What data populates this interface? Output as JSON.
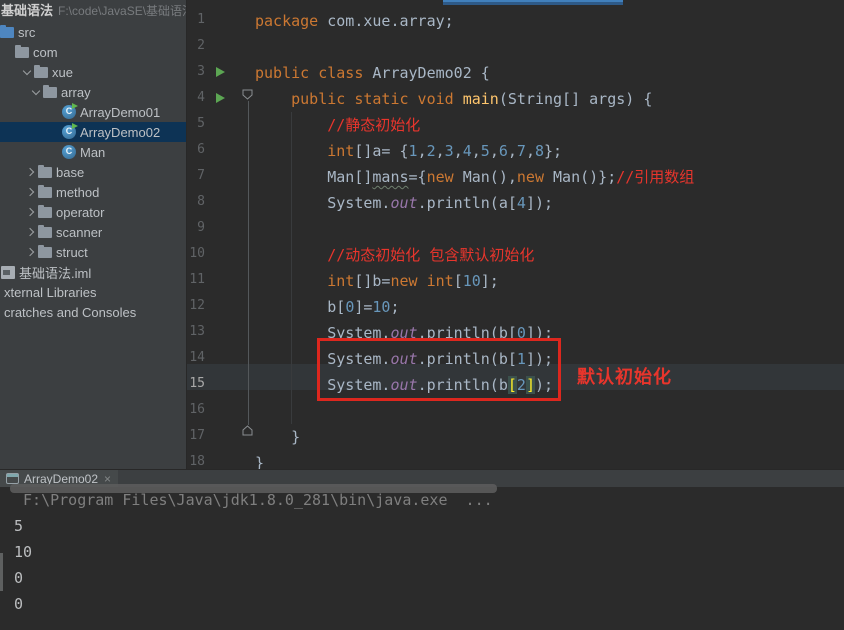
{
  "colors": {
    "annotation_red": "#E8352C",
    "tree_selection": "#0D3355",
    "keyword_orange": "#CC7832",
    "number_blue": "#6897BB",
    "run_green": "#5CA653",
    "tab_accent_blue": "#4180BC"
  },
  "project_panel": {
    "title": "基础语法",
    "path": "F:\\code\\JavaSE\\基础语法",
    "tree": [
      {
        "label": "src",
        "icon": "src-folder",
        "pad": 0
      },
      {
        "label": "com",
        "icon": "folder",
        "pad": 15
      },
      {
        "label": "xue",
        "icon": "folder",
        "chevron": "down",
        "pad": 22
      },
      {
        "label": "array",
        "icon": "folder",
        "chevron": "down",
        "pad": 31
      },
      {
        "label": "ArrayDemo01",
        "icon": "class-run",
        "pad": 62
      },
      {
        "label": "ArrayDemo02",
        "icon": "class-run",
        "pad": 62,
        "selected": true
      },
      {
        "label": "Man",
        "icon": "class",
        "pad": 62
      },
      {
        "label": "base",
        "icon": "folder",
        "chevron": "right",
        "pad": 26
      },
      {
        "label": "method",
        "icon": "folder",
        "chevron": "right",
        "pad": 26
      },
      {
        "label": "operator",
        "icon": "folder",
        "chevron": "right",
        "pad": 26
      },
      {
        "label": "scanner",
        "icon": "folder",
        "chevron": "right",
        "pad": 26
      },
      {
        "label": "struct",
        "icon": "folder",
        "chevron": "right",
        "pad": 26
      },
      {
        "label": "基础语法.iml",
        "icon": "module-file",
        "pad": 1
      },
      {
        "label": "xternal Libraries",
        "pad": 0
      },
      {
        "label": "cratches and Consoles",
        "pad": 0
      }
    ]
  },
  "editor": {
    "active_line": 15,
    "run_lines": [
      3,
      4
    ],
    "lines": [
      [
        {
          "t": "package",
          "c": "k"
        },
        {
          "t": " com.xue.array;",
          "c": "p"
        }
      ],
      [],
      [
        {
          "t": "public class",
          "c": "k"
        },
        {
          "t": " ArrayDemo02 {",
          "c": "p"
        }
      ],
      [
        {
          "t": "    ",
          "c": "p"
        },
        {
          "t": "public static void ",
          "c": "k"
        },
        {
          "t": "main",
          "c": "m"
        },
        {
          "t": "(String[] args) {",
          "c": "p"
        }
      ],
      [
        {
          "t": "        ",
          "c": "p"
        },
        {
          "t": "//静态初始化",
          "c": "c"
        }
      ],
      [
        {
          "t": "        ",
          "c": "p"
        },
        {
          "t": "int",
          "c": "k"
        },
        {
          "t": "[]a= {",
          "c": "p"
        },
        {
          "t": "1",
          "c": "n"
        },
        {
          "t": ",",
          "c": "p"
        },
        {
          "t": "2",
          "c": "n"
        },
        {
          "t": ",",
          "c": "p"
        },
        {
          "t": "3",
          "c": "n"
        },
        {
          "t": ",",
          "c": "p"
        },
        {
          "t": "4",
          "c": "n"
        },
        {
          "t": ",",
          "c": "p"
        },
        {
          "t": "5",
          "c": "n"
        },
        {
          "t": ",",
          "c": "p"
        },
        {
          "t": "6",
          "c": "n"
        },
        {
          "t": ",",
          "c": "p"
        },
        {
          "t": "7",
          "c": "n"
        },
        {
          "t": ",",
          "c": "p"
        },
        {
          "t": "8",
          "c": "n"
        },
        {
          "t": "};",
          "c": "p"
        }
      ],
      [
        {
          "t": "        ",
          "c": "p"
        },
        {
          "t": "Man[]",
          "c": "p"
        },
        {
          "t": "mans",
          "c": "u"
        },
        {
          "t": "={",
          "c": "p"
        },
        {
          "t": "new",
          "c": "k"
        },
        {
          "t": " Man()",
          "c": "p"
        },
        {
          "t": ",",
          "c": "p"
        },
        {
          "t": "new",
          "c": "k"
        },
        {
          "t": " Man()};",
          "c": "p"
        },
        {
          "t": "//引用数组",
          "c": "c"
        }
      ],
      [
        {
          "t": "        ",
          "c": "p"
        },
        {
          "t": "System.",
          "c": "p"
        },
        {
          "t": "out",
          "c": "f"
        },
        {
          "t": ".println(a[",
          "c": "p"
        },
        {
          "t": "4",
          "c": "n"
        },
        {
          "t": "]);",
          "c": "p"
        }
      ],
      [],
      [
        {
          "t": "        ",
          "c": "p"
        },
        {
          "t": "//动态初始化 包含默认初始化",
          "c": "c"
        }
      ],
      [
        {
          "t": "        ",
          "c": "p"
        },
        {
          "t": "int",
          "c": "k"
        },
        {
          "t": "[]b=",
          "c": "p"
        },
        {
          "t": "new ",
          "c": "k"
        },
        {
          "t": "int",
          "c": "k"
        },
        {
          "t": "[",
          "c": "p"
        },
        {
          "t": "10",
          "c": "n"
        },
        {
          "t": "];",
          "c": "p"
        }
      ],
      [
        {
          "t": "        ",
          "c": "p"
        },
        {
          "t": "b[",
          "c": "p"
        },
        {
          "t": "0",
          "c": "n"
        },
        {
          "t": "]=",
          "c": "p"
        },
        {
          "t": "10",
          "c": "n"
        },
        {
          "t": ";",
          "c": "p"
        }
      ],
      [
        {
          "t": "        ",
          "c": "p"
        },
        {
          "t": "System.",
          "c": "p"
        },
        {
          "t": "out",
          "c": "f"
        },
        {
          "t": ".println(b[",
          "c": "p"
        },
        {
          "t": "0",
          "c": "n"
        },
        {
          "t": "]);",
          "c": "p"
        }
      ],
      [
        {
          "t": "        ",
          "c": "p"
        },
        {
          "t": "System.",
          "c": "p"
        },
        {
          "t": "out",
          "c": "f"
        },
        {
          "t": ".println(b[",
          "c": "p"
        },
        {
          "t": "1",
          "c": "n"
        },
        {
          "t": "]);",
          "c": "p"
        }
      ],
      [
        {
          "t": "        ",
          "c": "p"
        },
        {
          "t": "System.",
          "c": "p"
        },
        {
          "t": "out",
          "c": "f"
        },
        {
          "t": ".println(b",
          "c": "p"
        },
        {
          "t": "[",
          "c": "bh"
        },
        {
          "t": "2",
          "c": "n"
        },
        {
          "t": "]",
          "c": "bh"
        },
        {
          "t": ");",
          "c": "p"
        }
      ],
      [],
      [
        {
          "t": "    }",
          "c": "p"
        }
      ],
      [
        {
          "t": "}",
          "c": "p"
        }
      ]
    ]
  },
  "annotation": {
    "label": "默认初始化"
  },
  "bottom_panel": {
    "tab": {
      "label": "ArrayDemo02",
      "close_glyph": "×"
    },
    "console": [
      {
        "text": " F:\\Program Files\\Java\\jdk1.8.0_281\\bin\\java.exe  ...",
        "kind": "cmd"
      },
      {
        "text": "5",
        "kind": "out"
      },
      {
        "text": "10",
        "kind": "out"
      },
      {
        "text": "0",
        "kind": "out"
      },
      {
        "text": "0",
        "kind": "out"
      }
    ]
  }
}
